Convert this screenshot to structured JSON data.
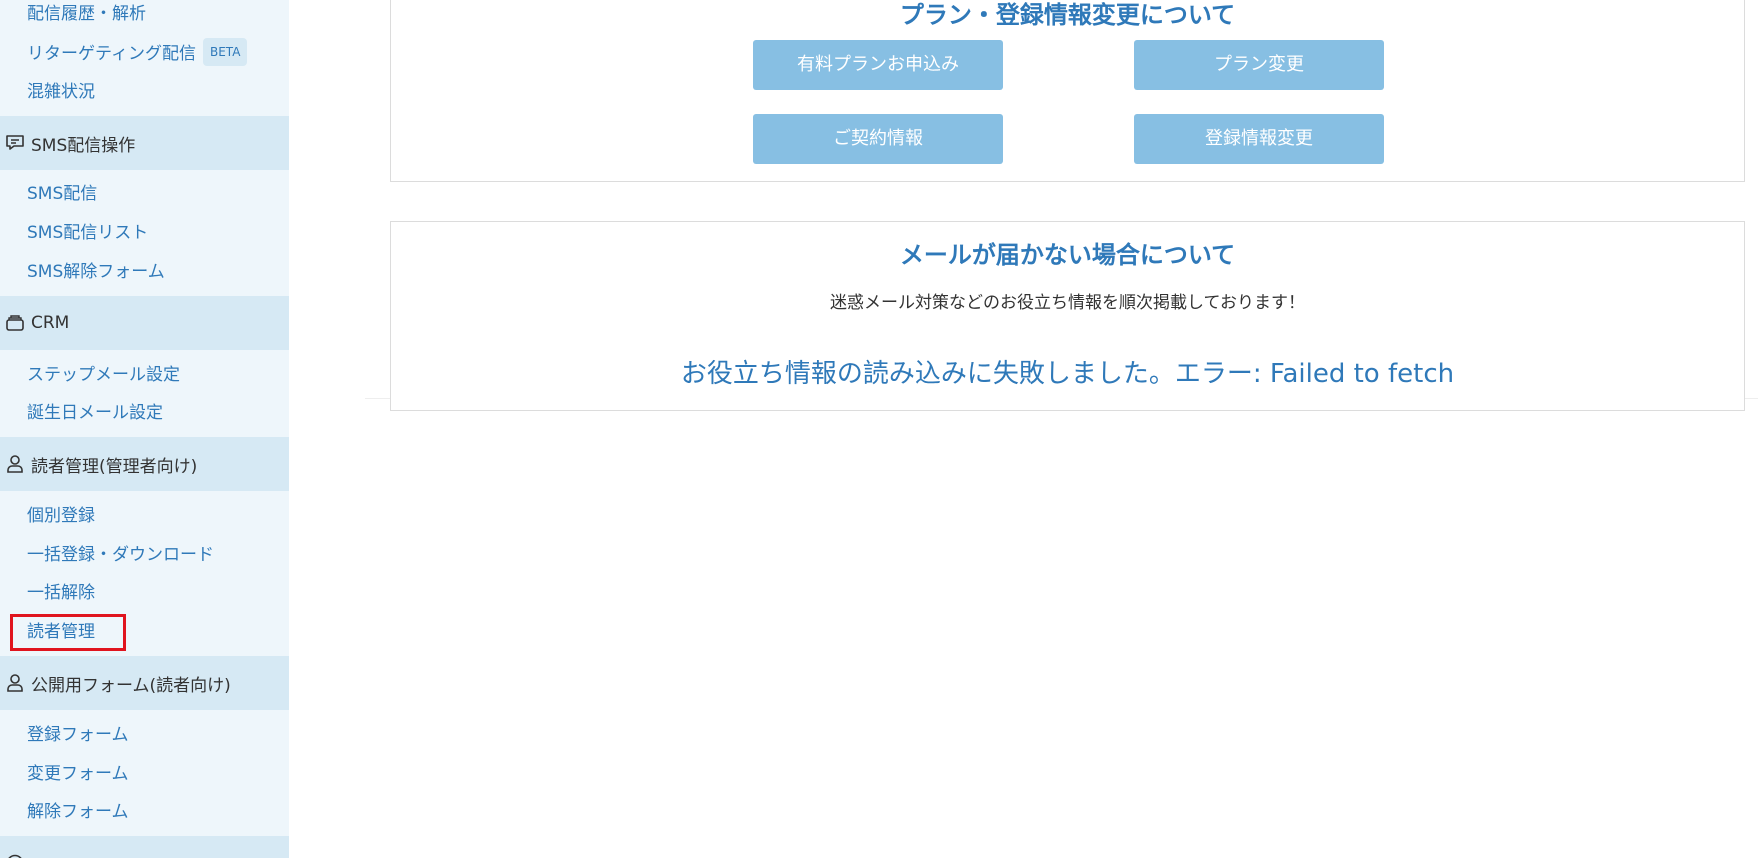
{
  "sidebar": {
    "top_items": [
      {
        "label": "配信履歴・解析"
      },
      {
        "label": "リターゲティング配信",
        "badge": "BETA"
      },
      {
        "label": "混雑状況"
      }
    ],
    "sms_section": {
      "icon": "message-icon",
      "title": "SMS配信操作",
      "items": [
        "SMS配信",
        "SMS配信リスト",
        "SMS解除フォーム"
      ]
    },
    "crm_section": {
      "icon": "briefcase-icon",
      "title": "CRM",
      "items": [
        "ステップメール設定",
        "誕生日メール設定"
      ]
    },
    "reader_admin_section": {
      "icon": "user-icon",
      "title": "読者管理(管理者向け)",
      "items": [
        "個別登録",
        "一括登録・ダウンロード",
        "一括解除",
        "読者管理"
      ]
    },
    "public_form_section": {
      "icon": "user-icon",
      "title": "公開用フォーム(読者向け)",
      "items": [
        "登録フォーム",
        "変更フォーム",
        "解除フォーム"
      ]
    }
  },
  "main": {
    "plan_panel": {
      "title": "プラン・登録情報変更について",
      "buttons": {
        "paid_plan": "有料プランお申込み",
        "plan_change": "プラン変更",
        "contract_info": "ご契約情報",
        "registration_change": "登録情報変更"
      }
    },
    "mail_panel": {
      "title": "メールが届かない場合について",
      "subtitle": "迷惑メール対策などのお役立ち情報を順次掲載しております！",
      "error": "お役立ち情報の読み込みに失敗しました。エラー: Failed to fetch"
    }
  },
  "colors": {
    "link": "#2f79b9",
    "button": "#87bfe3",
    "sidebar_bg": "#eef6fb",
    "section_bg": "#d6e9f4",
    "highlight": "#e0141e"
  }
}
